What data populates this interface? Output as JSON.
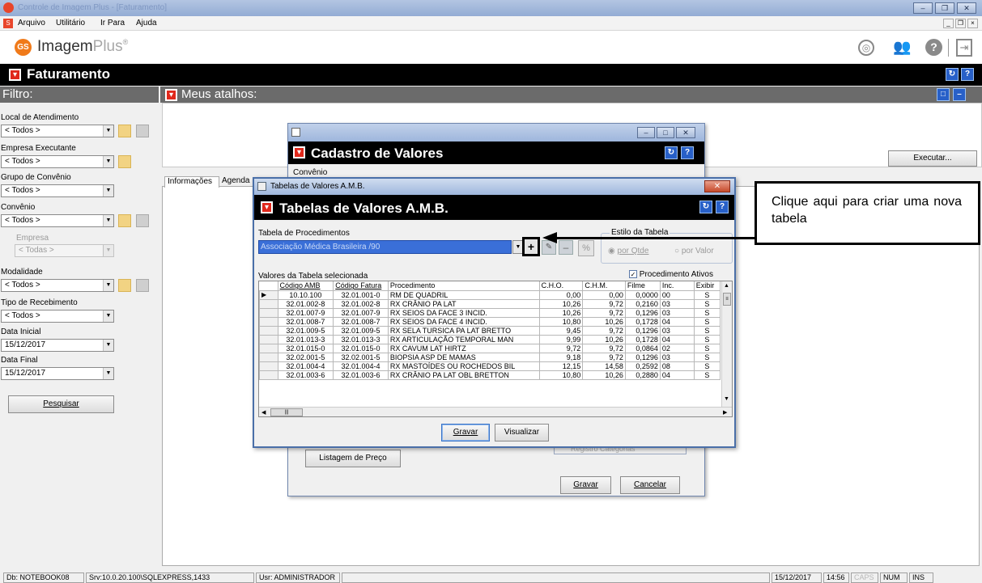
{
  "window": {
    "title": "Controle de Imagem Plus - [Faturamento]"
  },
  "menu": [
    {
      "label": "Arquivo"
    },
    {
      "label": "Utilitário"
    },
    {
      "label": "Ir Para"
    },
    {
      "label": "Ajuda"
    }
  ],
  "app": {
    "name_part1": "Imagem",
    "name_part2": "Plus",
    "reg": "®"
  },
  "module": {
    "title": "Faturamento"
  },
  "filter": {
    "title": "Filtro:",
    "fields": [
      {
        "label": "Local de Atendimento",
        "value": "< Todos >"
      },
      {
        "label": "Empresa Executante",
        "value": "< Todos >"
      },
      {
        "label": "Grupo de Convênio",
        "value": "< Todos >"
      },
      {
        "label": "Convênio",
        "value": "< Todos >"
      },
      {
        "label": "Empresa",
        "value": "< Todas >"
      },
      {
        "label": "Modalidade",
        "value": "< Todos >"
      },
      {
        "label": "Tipo de Recebimento",
        "value": "< Todos >"
      },
      {
        "label": "Data Inicial",
        "value": "15/12/2017"
      },
      {
        "label": "Data Final",
        "value": "15/12/2017"
      }
    ],
    "search_button": "Pesquisar"
  },
  "shortcuts": {
    "title": "Meus atalhos:",
    "execute_button": "Executar..."
  },
  "tabs": [
    {
      "label": "Informações"
    },
    {
      "label": "Agenda"
    }
  ],
  "cadastro": {
    "title": "Cadastro de Valores",
    "label_convenio": "Convênio",
    "list_button": "Listagem de Preço",
    "checkbox_label": "Registro Categorias",
    "save_button": "Gravar",
    "cancel_button": "Cancelar"
  },
  "amb": {
    "window_title": "Tabelas de Valores A.M.B.",
    "header_title": "Tabelas de Valores A.M.B.",
    "proc_label": "Tabela de Procedimentos",
    "proc_value": "Associação Médica Brasileira /90",
    "estilo_label": "Estilo da Tabela",
    "radio_qtde": "por Qtde",
    "radio_valor": "por Valor",
    "values_label": "Valores da Tabela selecionada",
    "active_checkbox": "Procedimento Ativos",
    "columns": [
      "Código AMB",
      "Código Fatura",
      "Procedimento",
      "C.H.O.",
      "C.H.M.",
      "Filme",
      "Inc.",
      "Exibir"
    ],
    "rows": [
      [
        "10.10.100",
        "32.01.001-0",
        "RM DE QUADRIL",
        "0,00",
        "0,00",
        "0,0000",
        "00",
        "S"
      ],
      [
        "32.01.002-8",
        "32.01.002-8",
        "RX CRÂNIO PA LAT",
        "10,26",
        "9,72",
        "0,2160",
        "03",
        "S"
      ],
      [
        "32.01.007-9",
        "32.01.007-9",
        "RX SEIOS DA FACE 3 INCID.",
        "10,26",
        "9,72",
        "0,1296",
        "03",
        "S"
      ],
      [
        "32.01.008-7",
        "32.01.008-7",
        "RX SEIOS DA FACE 4 INCID.",
        "10,80",
        "10,26",
        "0,1728",
        "04",
        "S"
      ],
      [
        "32.01.009-5",
        "32.01.009-5",
        "RX SELA TURSICA PA LAT BRETTO",
        "9,45",
        "9,72",
        "0,1296",
        "03",
        "S"
      ],
      [
        "32.01.013-3",
        "32.01.013-3",
        "RX ARTICULAÇÃO TEMPORAL MAN",
        "9,99",
        "10,26",
        "0,1728",
        "04",
        "S"
      ],
      [
        "32.01.015-0",
        "32.01.015-0",
        "RX CAVUM LAT HIRTZ",
        "9,72",
        "9,72",
        "0,0864",
        "02",
        "S"
      ],
      [
        "32.02.001-5",
        "32.02.001-5",
        "BIOPSIA ASP DE MAMAS",
        "9,18",
        "9,72",
        "0,1296",
        "03",
        "S"
      ],
      [
        "32.01.004-4",
        "32.01.004-4",
        "RX MASTOÍDES OU ROCHEDOS BIL",
        "12,15",
        "14,58",
        "0,2592",
        "08",
        "S"
      ],
      [
        "32.01.003-6",
        "32.01.003-6",
        "RX CRÂNIO PA LAT OBL BRETTON",
        "10,80",
        "10,26",
        "0,2880",
        "04",
        "S"
      ]
    ],
    "save_button": "Gravar",
    "view_button": "Visualizar"
  },
  "callout": {
    "text": "Clique aqui para criar uma nova tabela"
  },
  "status": {
    "db": "Db: NOTEBOOK08",
    "srv": "Srv:10.0.20.100\\SQLEXPRESS,1433",
    "usr": "Usr: ADMINISTRADOR",
    "date": "15/12/2017",
    "time": "14:56",
    "caps": "CAPS",
    "num": "NUM",
    "ins": "INS"
  },
  "colors": {
    "red": "#e0281b",
    "black": "#000000",
    "selection": "#3a6fd8",
    "gray_header": "#6b6b6b"
  }
}
